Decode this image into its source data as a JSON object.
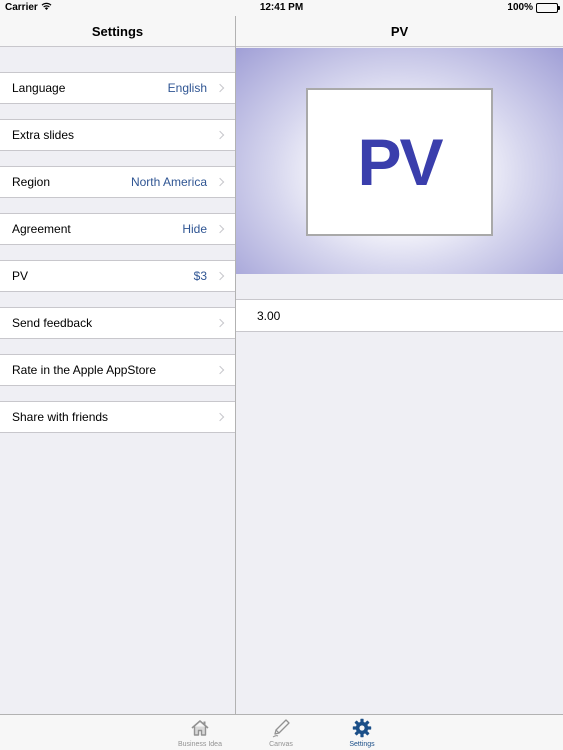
{
  "status_bar": {
    "carrier": "Carrier",
    "time": "12:41 PM",
    "battery": "100%"
  },
  "left_nav": {
    "title": "Settings"
  },
  "right_nav": {
    "title": "PV"
  },
  "settings": {
    "items": [
      {
        "label": "Language",
        "value": "English"
      },
      {
        "label": "Extra slides",
        "value": ""
      },
      {
        "label": "Region",
        "value": "North America"
      },
      {
        "label": "Agreement",
        "value": "Hide"
      },
      {
        "label": "PV",
        "value": "$3"
      },
      {
        "label": "Send feedback",
        "value": ""
      },
      {
        "label": "Rate in the Apple AppStore",
        "value": ""
      },
      {
        "label": "Share with friends",
        "value": ""
      }
    ]
  },
  "preview": {
    "text": "PV"
  },
  "value_field": {
    "value": "3.00"
  },
  "tab_bar": {
    "tabs": [
      {
        "label": "Business Idea",
        "icon": "house-icon"
      },
      {
        "label": "Canvas",
        "icon": "pencil-icon"
      },
      {
        "label": "Settings",
        "icon": "gear-icon",
        "active": true
      }
    ]
  },
  "colors": {
    "accent": "#1b4f88",
    "value_text": "#2f5593",
    "preview_letters": "#3a3eac"
  }
}
